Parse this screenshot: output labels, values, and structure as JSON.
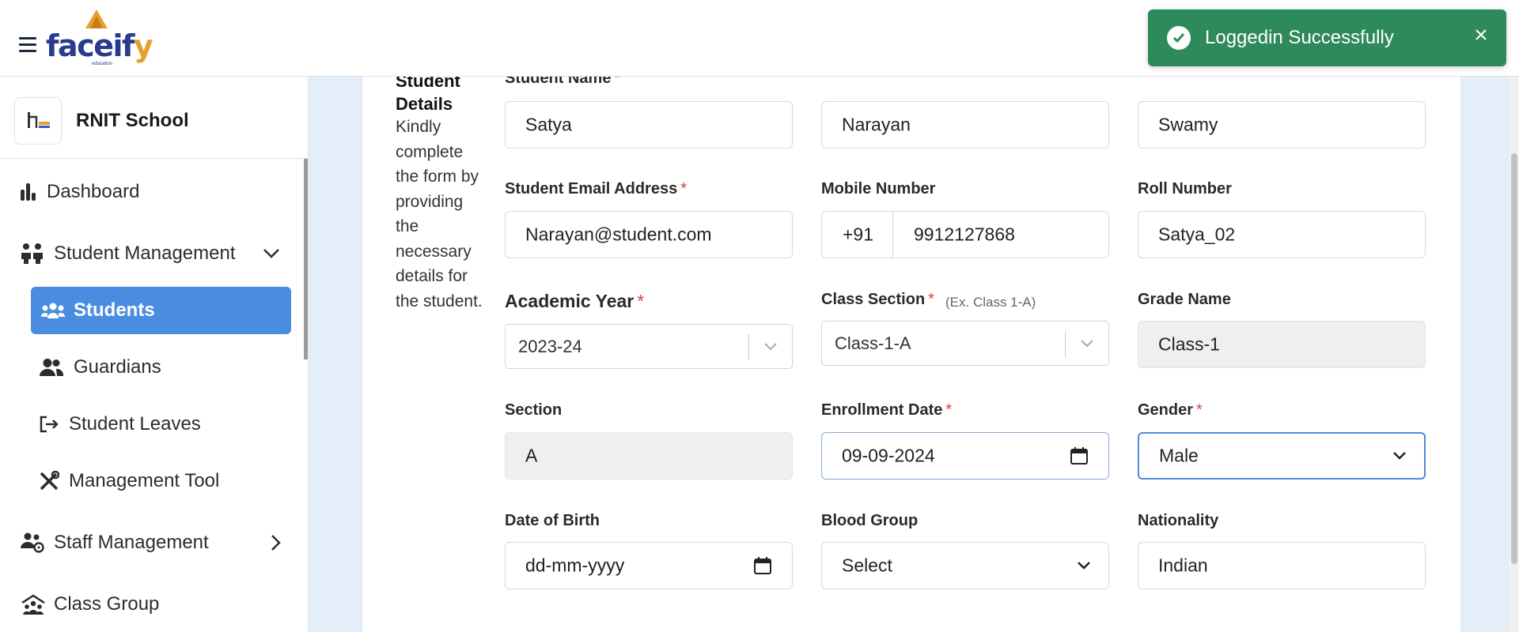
{
  "app": {
    "brand": "facei",
    "brand_y": "f",
    "brand_tail": "y",
    "brand_sub": "education"
  },
  "toast": {
    "message": "Loggedin Successfully"
  },
  "school": {
    "name": "RNIT School"
  },
  "nav": {
    "dashboard": "Dashboard",
    "student_management": "Student Management",
    "students": "Students",
    "guardians": "Guardians",
    "student_leaves": "Student Leaves",
    "management_tool": "Management Tool",
    "staff_management": "Staff Management",
    "class_group": "Class Group"
  },
  "section": {
    "title_line1": "Student",
    "title_line2": "Details",
    "description": "Kindly complete the form by providing the necessary details for the student."
  },
  "form": {
    "student_name": {
      "label": "Student Name",
      "required": "*",
      "first": "Satya",
      "middle": "Narayan",
      "last": "Swamy"
    },
    "email": {
      "label": "Student Email Address",
      "required": "*",
      "value": "Narayan@student.com"
    },
    "mobile": {
      "label": "Mobile Number",
      "prefix": "+91",
      "value": "9912127868"
    },
    "roll": {
      "label": "Roll Number",
      "value": "Satya_02"
    },
    "academic_year": {
      "label": "Academic Year",
      "required": "*",
      "value": "2023-24"
    },
    "class_section": {
      "label": "Class Section",
      "required": "*",
      "hint": "(Ex. Class 1-A)",
      "value": "Class-1-A"
    },
    "grade_name": {
      "label": "Grade Name",
      "value": "Class-1"
    },
    "section": {
      "label": "Section",
      "value": "A"
    },
    "enrollment_date": {
      "label": "Enrollment Date",
      "required": "*",
      "value": "09-09-2024"
    },
    "gender": {
      "label": "Gender",
      "required": "*",
      "value": "Male"
    },
    "dob": {
      "label": "Date of Birth",
      "placeholder": "dd-mm-yyyy"
    },
    "blood_group": {
      "label": "Blood Group",
      "value": "Select"
    },
    "nationality": {
      "label": "Nationality",
      "value": "Indian"
    }
  },
  "colors": {
    "accent": "#4a8de0",
    "toast": "#2e8a5a",
    "required": "#e03a3a",
    "brand": "#2a3a8c"
  }
}
